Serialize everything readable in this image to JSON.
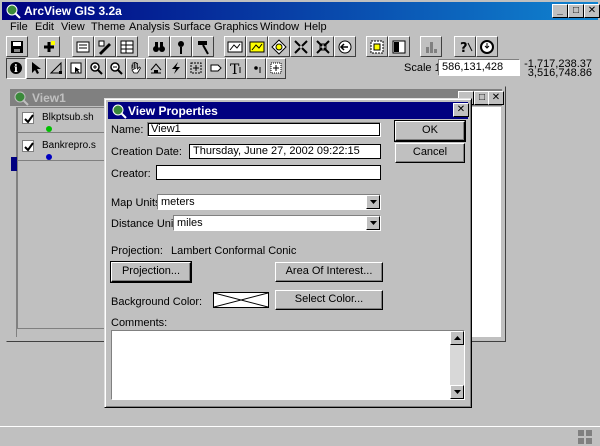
{
  "app": {
    "title": "ArcView GIS 3.2a",
    "menus": [
      "File",
      "Edit",
      "View",
      "Theme",
      "Analysis",
      "Surface",
      "Graphics",
      "Window",
      "Help"
    ],
    "scale_label": "Scale 1:",
    "scale_value": "586,131,428",
    "coord_x": "-1,717,238.37",
    "coord_y": "3,516,748.86",
    "caption_minimize": "_",
    "caption_maximize": "□",
    "caption_close": "✕"
  },
  "view_window": {
    "title": "View1",
    "themes": [
      {
        "label": "Blkptsub.sh",
        "checked": true,
        "color": "#00c000"
      },
      {
        "label": "Bankrepro.s",
        "checked": true,
        "color": "#0000c0"
      }
    ]
  },
  "dialog": {
    "title": "View Properties",
    "name_label": "Name:",
    "name_value": "View1",
    "creation_date_label": "Creation Date:",
    "creation_date_value": "Thursday, June 27, 2002 09:22:15",
    "creator_label": "Creator:",
    "creator_value": "",
    "map_units_label": "Map Units:",
    "map_units_value": "meters",
    "distance_units_label": "Distance Units:",
    "distance_units_value": "miles",
    "projection_label": "Projection:",
    "projection_value": "Lambert Conformal Conic",
    "projection_button": "Projection...",
    "area_of_interest_button": "Area Of Interest...",
    "background_color_label": "Background Color:",
    "select_color_button": "Select Color...",
    "comments_label": "Comments:",
    "comments_value": "",
    "ok_button": "OK",
    "cancel_button": "Cancel"
  }
}
